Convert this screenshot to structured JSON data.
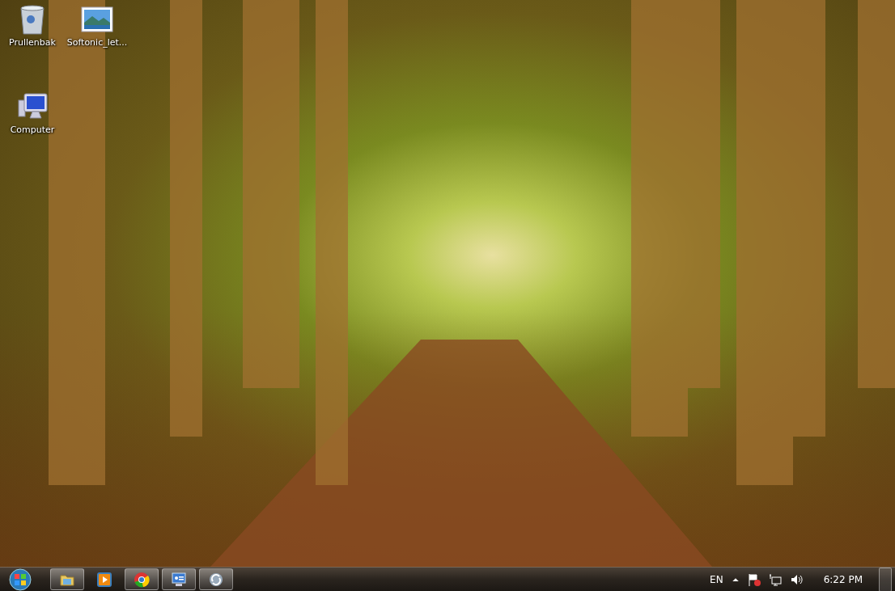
{
  "desktop": {
    "icons": [
      {
        "kind": "recycle-bin",
        "label": "Prullenbak"
      },
      {
        "kind": "picture",
        "label": "Softonic_let..."
      },
      {
        "kind": "computer",
        "label": "Computer"
      }
    ]
  },
  "taskbar": {
    "apps": [
      {
        "kind": "folder",
        "running": true
      },
      {
        "kind": "media",
        "running": false
      },
      {
        "kind": "chrome",
        "running": true
      },
      {
        "kind": "remote",
        "running": true
      },
      {
        "kind": "swirl",
        "running": true
      }
    ],
    "language": "EN",
    "clock": "6:22 PM"
  }
}
